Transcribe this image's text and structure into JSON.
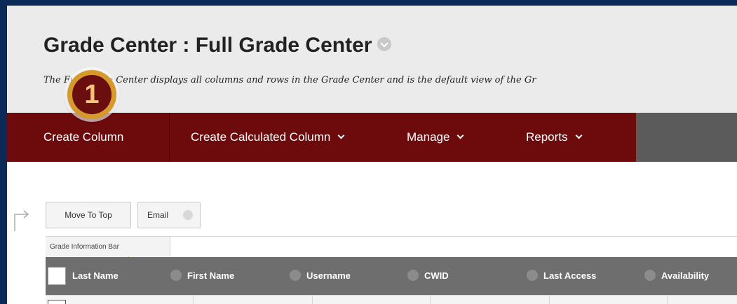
{
  "header": {
    "title": "Grade Center : Full Grade Center",
    "description": "The Full Grade Center displays all columns and rows in the Grade Center and is the default view of the Gr"
  },
  "callout": {
    "number": "1"
  },
  "nav": {
    "create_column": "Create Column",
    "create_calculated_column": "Create Calculated Column",
    "manage": "Manage",
    "reports": "Reports"
  },
  "toolbar": {
    "move_to_top": "Move To Top",
    "email": "Email"
  },
  "info_bar": {
    "label": "Grade Information Bar"
  },
  "table": {
    "columns": [
      "Last Name",
      "First Name",
      "Username",
      "CWID",
      "Last Access",
      "Availability"
    ]
  },
  "colors": {
    "nav_background": "#6d0a0c",
    "header_background": "#ebebeb",
    "table_header_background": "#6e6e6e",
    "callout_ring": "#d69a2a",
    "page_frame": "#0b2a57"
  },
  "icons": [
    "chevron-down-icon",
    "return-arrow-icon",
    "info-caret-icon"
  ]
}
